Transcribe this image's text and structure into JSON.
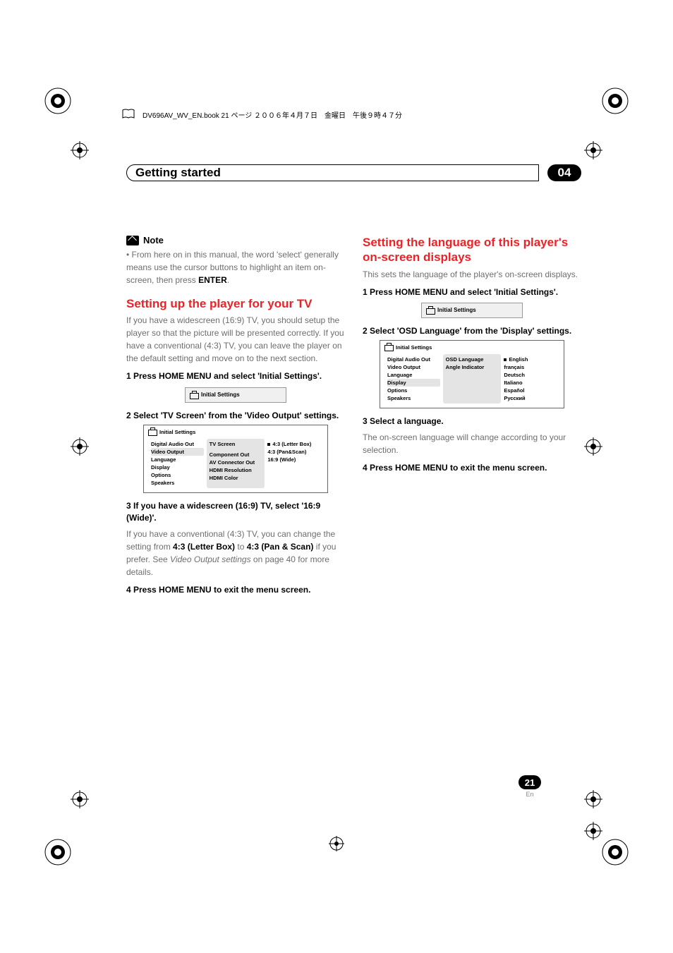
{
  "header": {
    "book_line": "DV696AV_WV_EN.book  21 ページ  ２００６年４月７日　金曜日　午後９時４７分"
  },
  "title_bar": {
    "label": "Getting started",
    "chapter": "04"
  },
  "left": {
    "note_label": "Note",
    "note_body_a": "From here on in this manual, the word 'select' generally means use the cursor buttons to highlight an item on-screen, then press ",
    "note_body_b": "ENTER",
    "note_body_c": ".",
    "bullet": "•",
    "h2": "Setting up the player for your TV",
    "intro": "If you have a widescreen (16:9) TV, you should setup the player so that the picture will be presented correctly. If you have a conventional (4:3) TV, you can leave the player on the default setting and move on to the next section.",
    "step1": "1    Press HOME MENU and select 'Initial Settings'.",
    "button1_label": "Initial Settings",
    "step2": "2    Select 'TV Screen' from the 'Video Output' settings.",
    "panel1": {
      "title": "Initial Settings",
      "left_items": [
        "Digital Audio Out",
        "Video Output",
        "Language",
        "Display",
        "Options",
        "Speakers"
      ],
      "mid_items": [
        "TV Screen",
        "Component Out",
        "AV Connector Out",
        "HDMI Resolution",
        "HDMI Color"
      ],
      "right_items": [
        "4:3 (Letter Box)",
        "4:3 (Pan&Scan)",
        "16:9 (Wide)"
      ]
    },
    "step3": "3    If you have a widescreen (16:9) TV, select '16:9 (Wide)'.",
    "post3_a": "If you have a conventional (4:3) TV, you can change the setting from ",
    "post3_b": "4:3 (Letter Box)",
    "post3_c": " to ",
    "post3_d": "4:3 (Pan & Scan)",
    "post3_e": " if you prefer. See ",
    "post3_f": "Video Output settings",
    "post3_g": " on page 40 for more details.",
    "step4": "4    Press HOME MENU to exit the menu screen."
  },
  "right": {
    "h2": "Setting the language of this player's on-screen displays",
    "intro": "This sets the language of the player's on-screen displays.",
    "step1": "1    Press HOME MENU and select 'Initial Settings'.",
    "button1_label": "Initial Settings",
    "step2": "2    Select 'OSD Language' from the 'Display' settings.",
    "panel1": {
      "title": "Initial Settings",
      "left_items": [
        "Digital Audio Out",
        "Video Output",
        "Language",
        "Display",
        "Options",
        "Speakers"
      ],
      "mid_items": [
        "OSD Language",
        "Angle Indicator"
      ],
      "right_items": [
        "English",
        "français",
        "Deutsch",
        "Italiano",
        "Español",
        "Русский"
      ]
    },
    "step3": "3    Select a language.",
    "post3": "The on-screen language will change according to your selection.",
    "step4": "4    Press HOME MENU to exit the menu screen."
  },
  "footer": {
    "page": "21",
    "lang": "En"
  }
}
